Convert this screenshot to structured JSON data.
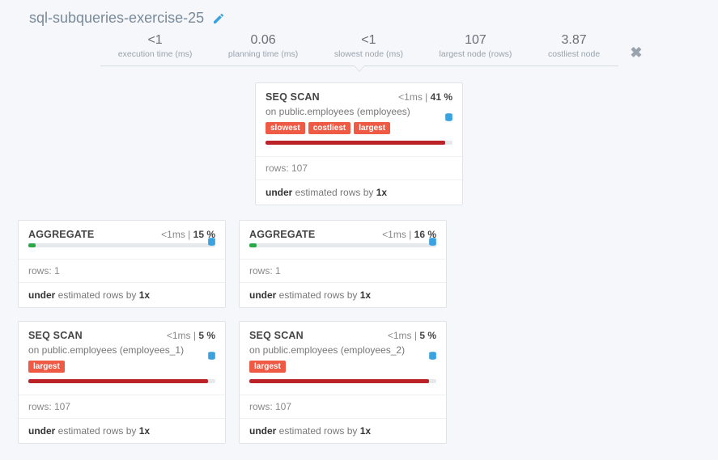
{
  "title": "sql-subqueries-exercise-25",
  "stats": [
    {
      "val": "<1",
      "lbl": "execution time (ms)"
    },
    {
      "val": "0.06",
      "lbl": "planning time (ms)"
    },
    {
      "val": "<1",
      "lbl": "slowest node (ms)"
    },
    {
      "val": "107",
      "lbl": "largest node (rows)"
    },
    {
      "val": "3.87",
      "lbl": "costliest node"
    }
  ],
  "nodes": {
    "root": {
      "op": "SEQ SCAN",
      "time": "<1ms",
      "pct": "41 %",
      "sub": "on public.employees (employees)",
      "badges": [
        "slowest",
        "costliest",
        "largest"
      ],
      "bar_color": "red",
      "bar_pct": 96,
      "rows": "rows: 107",
      "est_pre": "under",
      "est_mid": " estimated rows by ",
      "est_mult": "1x"
    },
    "agg_l": {
      "op": "AGGREGATE",
      "time": "<1ms",
      "pct": "15 %",
      "bar_color": "green",
      "bar_pct": 4,
      "rows": "rows: 1",
      "est_pre": "under",
      "est_mid": " estimated rows by ",
      "est_mult": "1x"
    },
    "agg_r": {
      "op": "AGGREGATE",
      "time": "<1ms",
      "pct": "16 %",
      "bar_color": "green",
      "bar_pct": 4,
      "rows": "rows: 1",
      "est_pre": "under",
      "est_mid": " estimated rows by ",
      "est_mult": "1x"
    },
    "seq_l": {
      "op": "SEQ SCAN",
      "time": "<1ms",
      "pct": "5 %",
      "sub": "on public.employees (employees_1)",
      "badges": [
        "largest"
      ],
      "bar_color": "red",
      "bar_pct": 96,
      "rows": "rows: 107",
      "est_pre": "under",
      "est_mid": " estimated rows by ",
      "est_mult": "1x"
    },
    "seq_r": {
      "op": "SEQ SCAN",
      "time": "<1ms",
      "pct": "5 %",
      "sub": "on public.employees (employees_2)",
      "badges": [
        "largest"
      ],
      "bar_color": "red",
      "bar_pct": 96,
      "rows": "rows: 107",
      "est_pre": "under",
      "est_mid": " estimated rows by ",
      "est_mult": "1x"
    }
  }
}
